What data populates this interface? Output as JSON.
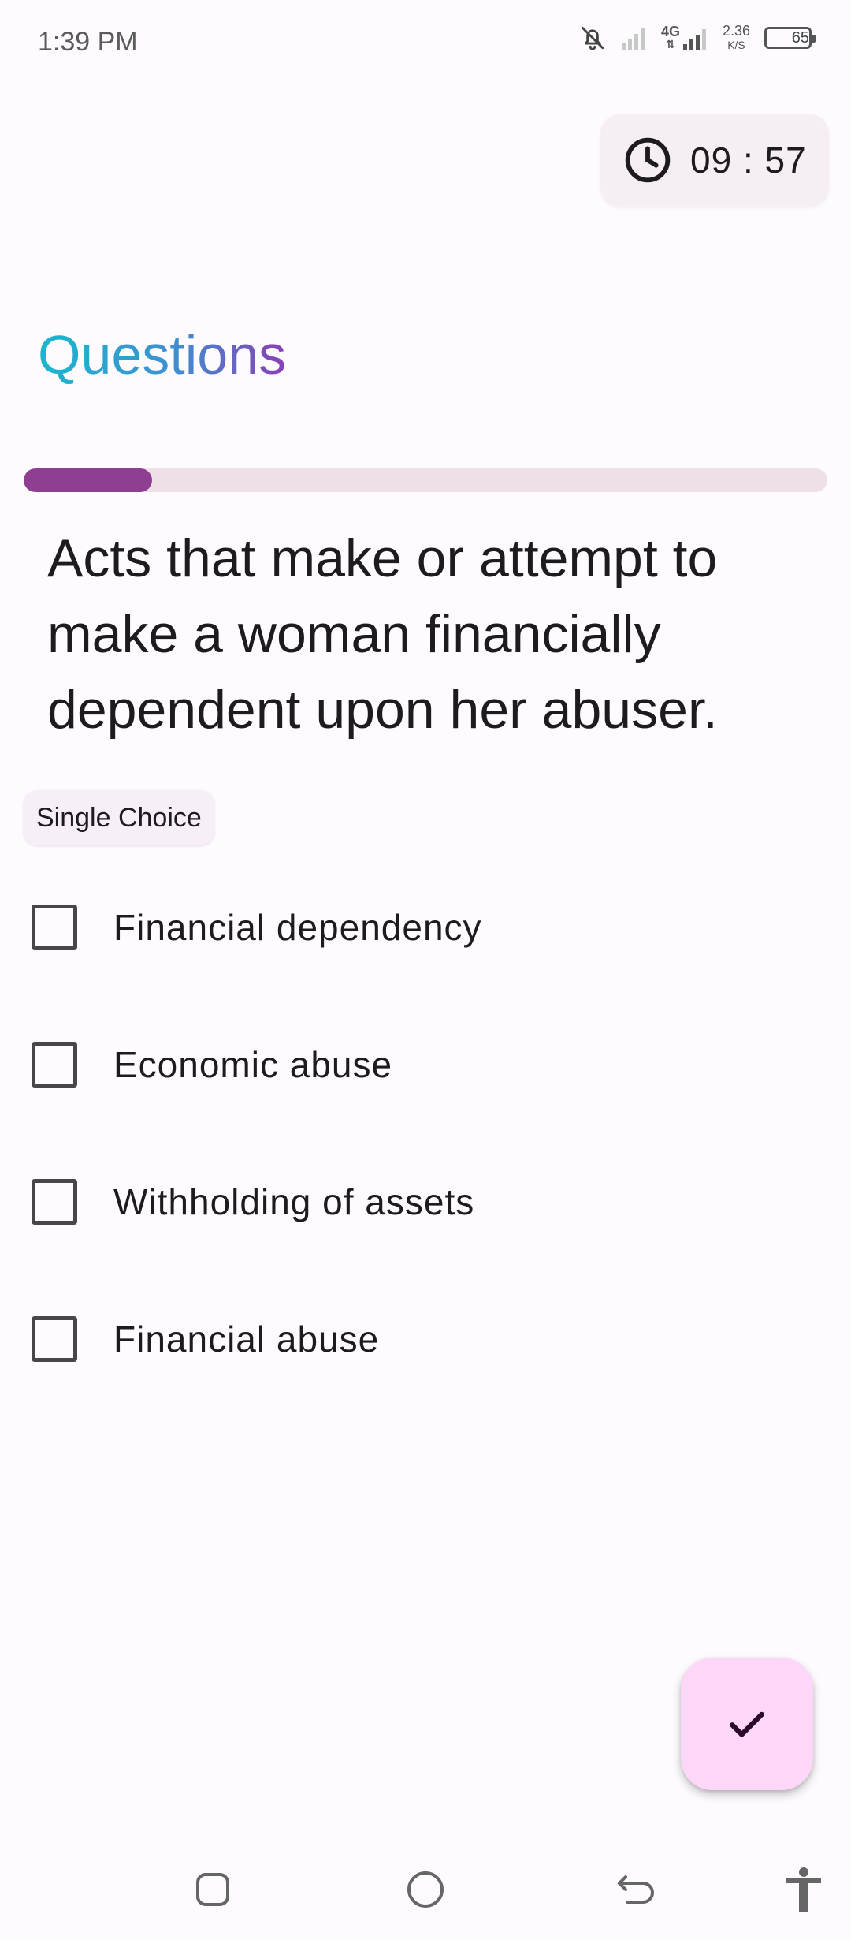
{
  "status_bar": {
    "time": "1:39 PM",
    "network_type": "4G",
    "speed_value": "2.36",
    "speed_unit": "K/S",
    "battery_level": "65",
    "icons": [
      "bell-off-icon",
      "signal-icon",
      "signal-4g-icon",
      "battery-icon"
    ]
  },
  "timer": {
    "icon": "clock-icon",
    "value": "09 : 57"
  },
  "header": {
    "title": "Questions"
  },
  "progress": {
    "fraction": 0.16,
    "color": "#8e3f91",
    "track_color": "#efdfe9"
  },
  "question": {
    "text": "Acts that make or attempt to make a woman financially dependent upon her abuser.",
    "type_label": "Single Choice"
  },
  "options": [
    {
      "label": "Financial dependency",
      "checked": false
    },
    {
      "label": "Economic abuse",
      "checked": false
    },
    {
      "label": "Withholding of assets",
      "checked": false
    },
    {
      "label": "Financial abuse",
      "checked": false
    }
  ],
  "fab": {
    "icon": "check-icon",
    "color": "#fcd7f8"
  },
  "nav_bar": {
    "icons": [
      "recents-icon",
      "home-icon",
      "back-icon",
      "accessibility-icon"
    ]
  },
  "colors": {
    "title_gradient_start": "#19b7cf",
    "title_gradient_end": "#8a3fb6",
    "background": "#fefbff"
  }
}
